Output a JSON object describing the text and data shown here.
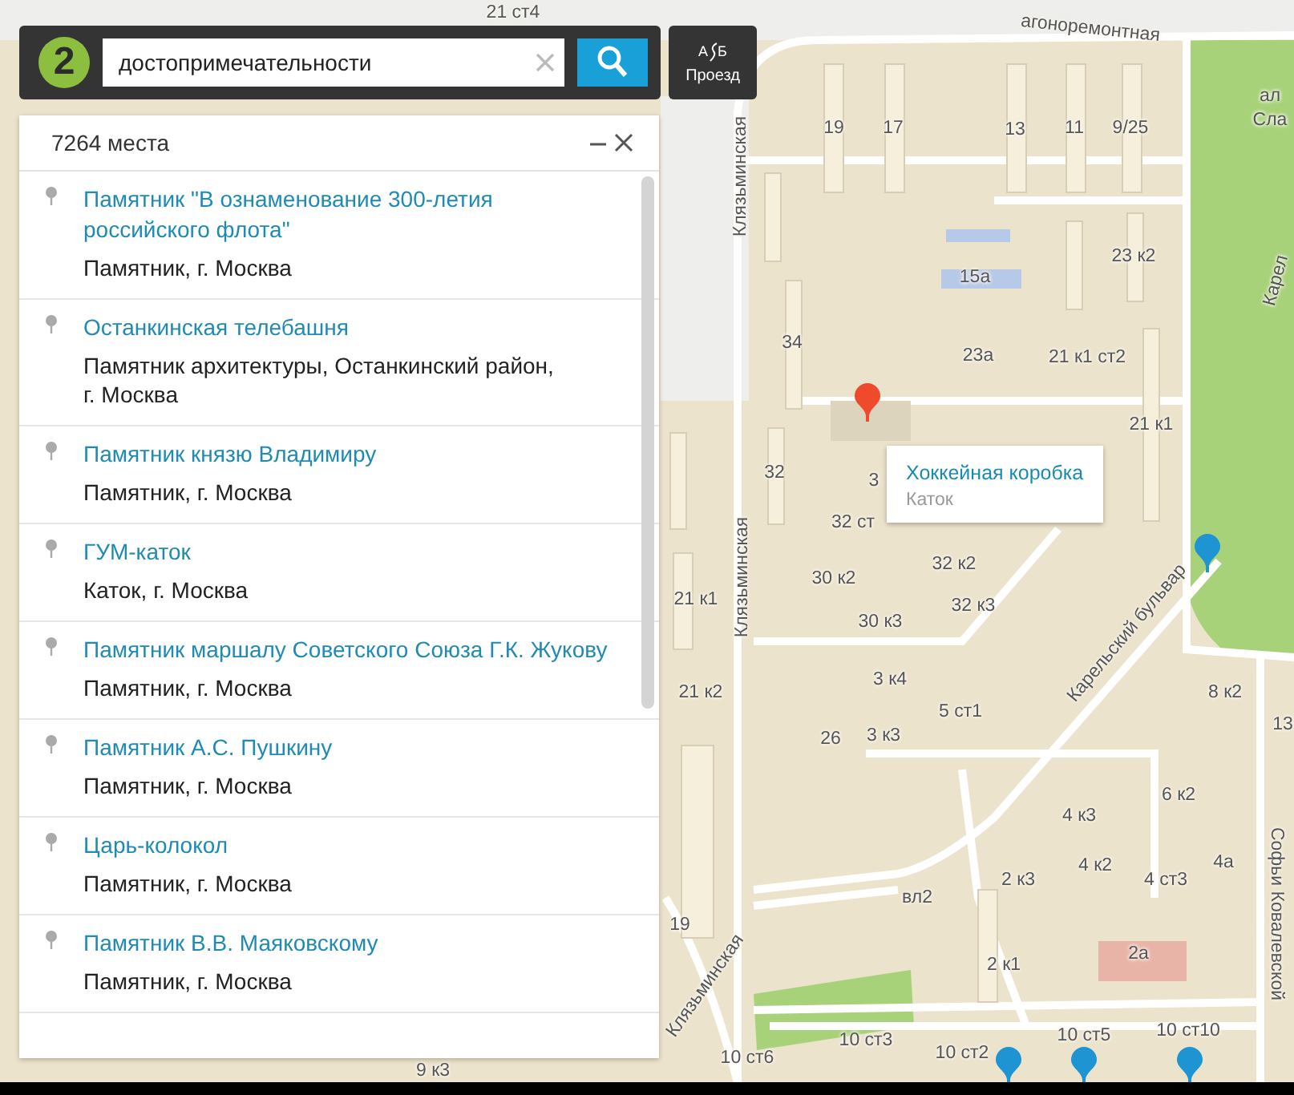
{
  "logo": {
    "text": "2"
  },
  "search": {
    "value": "достопримечательности"
  },
  "route_button": {
    "label": "Проезд",
    "icon_from": "А",
    "icon_to": "Б"
  },
  "results": {
    "count": "7264 места",
    "items": [
      {
        "title": "Памятник \"В ознаменование 300-летия российского флота\"",
        "subtitle": "Памятник, г. Москва"
      },
      {
        "title": "Останкинская телебашня",
        "subtitle": "Памятник архитектуры, Останкинский район, г. Москва"
      },
      {
        "title": "Памятник князю Владимиру",
        "subtitle": "Памятник, г. Москва"
      },
      {
        "title": "ГУМ-каток",
        "subtitle": "Каток, г. Москва"
      },
      {
        "title": "Памятник маршалу Советского Союза Г.К. Жукову",
        "subtitle": "Памятник, г. Москва"
      },
      {
        "title": "Памятник А.С. Пушкину",
        "subtitle": "Памятник, г. Москва"
      },
      {
        "title": "Царь-колокол",
        "subtitle": "Памятник, г. Москва"
      },
      {
        "title": "Памятник В.В. Маяковскому",
        "subtitle": "Памятник, г. Москва"
      }
    ]
  },
  "map": {
    "labels": [
      "21 ст4",
      "агоноремонтная",
      "19",
      "17",
      "13",
      "11",
      "9/25",
      "ал",
      "Сла",
      "Клязьминская",
      "15а",
      "23 к2",
      "Карел",
      "34",
      "23а",
      "21 к1 ст2",
      "21 к1",
      "32",
      "3",
      "32 ст",
      "Клязьминская",
      "30 к2",
      "32 к2",
      "21 к1",
      "32 к3",
      "30 к3",
      "21 к2",
      "3 к4",
      "5 ст1",
      "26",
      "3 к3",
      "Карельский бульвар",
      "8 к2",
      "13",
      "6 к2",
      "4 к3",
      "4 к2",
      "2 к3",
      "4 ст3",
      "4а",
      "вл2",
      "19",
      "2 к1",
      "2а",
      "Софьи Ковалевской",
      "Клязьминская",
      "10 ст6",
      "10 ст3",
      "10 ст2",
      "10 ст5",
      "10 ст10",
      "9 к3"
    ],
    "popup": {
      "title": "Хоккейная коробка",
      "subtitle": "Каток"
    }
  }
}
